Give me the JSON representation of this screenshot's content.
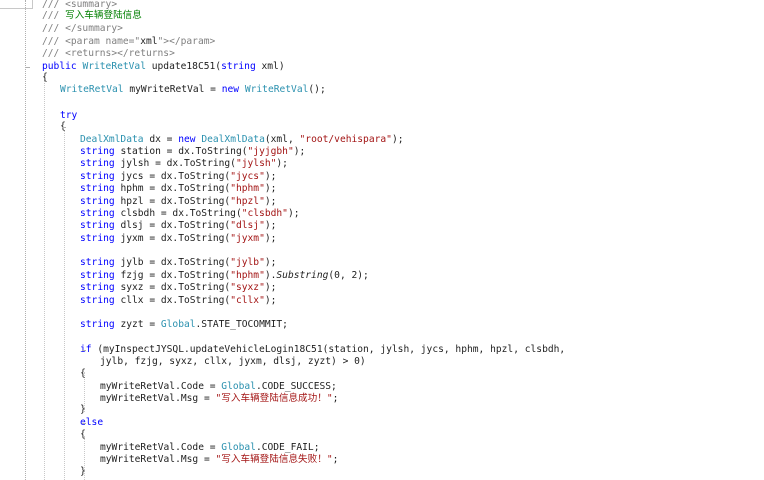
{
  "editor": {
    "lines": [
      [
        {
          "t": "/// ",
          "c": "com"
        },
        {
          "t": "<summary>",
          "c": "com"
        }
      ],
      [
        {
          "t": "/// ",
          "c": "com"
        },
        {
          "t": "写入车辆登陆信息",
          "c": "comtext"
        }
      ],
      [
        {
          "t": "/// ",
          "c": "com"
        },
        {
          "t": "</summary>",
          "c": "com"
        }
      ],
      [
        {
          "t": "/// ",
          "c": "com"
        },
        {
          "t": "<param name=\"",
          "c": "com"
        },
        {
          "t": "xml",
          "c": "plain"
        },
        {
          "t": "\"></param>",
          "c": "com"
        }
      ],
      [
        {
          "t": "/// ",
          "c": "com"
        },
        {
          "t": "<returns></returns>",
          "c": "com"
        }
      ],
      [
        {
          "t": "public ",
          "c": "kw"
        },
        {
          "t": "WriteRetVal ",
          "c": "type"
        },
        {
          "t": "update18C51(",
          "c": "plain"
        },
        {
          "t": "string ",
          "c": "kw"
        },
        {
          "t": "xml)",
          "c": "plain"
        }
      ],
      [
        {
          "t": "{",
          "c": "plain"
        }
      ],
      [],
      [
        {
          "t": "WriteRetVal ",
          "c": "type"
        },
        {
          "t": "myWriteRetVal = ",
          "c": "plain"
        },
        {
          "t": "new ",
          "c": "kw"
        },
        {
          "t": "WriteRetVal",
          "c": "type"
        },
        {
          "t": "();",
          "c": "plain"
        }
      ],
      [],
      [
        {
          "t": "try",
          "c": "kw"
        }
      ],
      [
        {
          "t": "{",
          "c": "plain"
        }
      ],
      [
        {
          "t": "DealXmlData ",
          "c": "type"
        },
        {
          "t": "dx = ",
          "c": "plain"
        },
        {
          "t": "new ",
          "c": "kw"
        },
        {
          "t": "DealXmlData",
          "c": "type"
        },
        {
          "t": "(xml, ",
          "c": "plain"
        },
        {
          "t": "\"root/vehispara\"",
          "c": "str"
        },
        {
          "t": ");",
          "c": "plain"
        }
      ],
      [
        {
          "t": "string ",
          "c": "kw"
        },
        {
          "t": "station = dx.ToString(",
          "c": "plain"
        },
        {
          "t": "\"jyjgbh\"",
          "c": "str"
        },
        {
          "t": ");",
          "c": "plain"
        }
      ],
      [
        {
          "t": "string ",
          "c": "kw"
        },
        {
          "t": "jylsh = dx.ToString(",
          "c": "plain"
        },
        {
          "t": "\"jylsh\"",
          "c": "str"
        },
        {
          "t": ");",
          "c": "plain"
        }
      ],
      [
        {
          "t": "string ",
          "c": "kw"
        },
        {
          "t": "jycs = dx.ToString(",
          "c": "plain"
        },
        {
          "t": "\"jycs\"",
          "c": "str"
        },
        {
          "t": ");",
          "c": "plain"
        }
      ],
      [
        {
          "t": "string ",
          "c": "kw"
        },
        {
          "t": "hphm = dx.ToString(",
          "c": "plain"
        },
        {
          "t": "\"hphm\"",
          "c": "str"
        },
        {
          "t": ");",
          "c": "plain"
        }
      ],
      [
        {
          "t": "string ",
          "c": "kw"
        },
        {
          "t": "hpzl = dx.ToString(",
          "c": "plain"
        },
        {
          "t": "\"hpzl\"",
          "c": "str"
        },
        {
          "t": ");",
          "c": "plain"
        }
      ],
      [
        {
          "t": "string ",
          "c": "kw"
        },
        {
          "t": "clsbdh = dx.ToString(",
          "c": "plain"
        },
        {
          "t": "\"clsbdh\"",
          "c": "str"
        },
        {
          "t": ");",
          "c": "plain"
        }
      ],
      [
        {
          "t": "string ",
          "c": "kw"
        },
        {
          "t": "dlsj = dx.ToString(",
          "c": "plain"
        },
        {
          "t": "\"dlsj\"",
          "c": "str"
        },
        {
          "t": ");",
          "c": "plain"
        }
      ],
      [
        {
          "t": "string ",
          "c": "kw"
        },
        {
          "t": "jyxm = dx.ToString(",
          "c": "plain"
        },
        {
          "t": "\"jyxm\"",
          "c": "str"
        },
        {
          "t": ");",
          "c": "plain"
        }
      ],
      [],
      [
        {
          "t": "string ",
          "c": "kw"
        },
        {
          "t": "jylb = dx.ToString(",
          "c": "plain"
        },
        {
          "t": "\"jylb\"",
          "c": "str"
        },
        {
          "t": ");",
          "c": "plain"
        }
      ],
      [
        {
          "t": "string ",
          "c": "kw"
        },
        {
          "t": "fzjg = dx.ToString(",
          "c": "plain"
        },
        {
          "t": "\"hphm\"",
          "c": "str"
        },
        {
          "t": ").",
          "c": "plain"
        },
        {
          "t": "Substring",
          "c": "it"
        },
        {
          "t": "(0, 2);",
          "c": "plain"
        }
      ],
      [
        {
          "t": "string ",
          "c": "kw"
        },
        {
          "t": "syxz = dx.ToString(",
          "c": "plain"
        },
        {
          "t": "\"syxz\"",
          "c": "str"
        },
        {
          "t": ");",
          "c": "plain"
        }
      ],
      [
        {
          "t": "string ",
          "c": "kw"
        },
        {
          "t": "cllx = dx.ToString(",
          "c": "plain"
        },
        {
          "t": "\"cllx\"",
          "c": "str"
        },
        {
          "t": ");",
          "c": "plain"
        }
      ],
      [],
      [
        {
          "t": "string ",
          "c": "kw"
        },
        {
          "t": "zyzt = ",
          "c": "plain"
        },
        {
          "t": "Global",
          "c": "type"
        },
        {
          "t": ".STATE_TOCOMMIT;",
          "c": "plain"
        }
      ],
      [],
      [
        {
          "t": "if ",
          "c": "kw"
        },
        {
          "t": "(myInspectJYSQL.updateVehicleLogin18C51(station, jylsh, jycs, hphm, hpzl, clsbdh,",
          "c": "plain"
        }
      ],
      [
        {
          "t": "jylb, fzjg, syxz, cllx, jyxm, dlsj, zyzt) > 0)",
          "c": "plain"
        }
      ],
      [
        {
          "t": "{",
          "c": "plain"
        }
      ],
      [
        {
          "t": "myWriteRetVal.Code = ",
          "c": "plain"
        },
        {
          "t": "Global",
          "c": "type"
        },
        {
          "t": ".CODE_SUCCESS;",
          "c": "plain"
        }
      ],
      [
        {
          "t": "myWriteRetVal.Msg = ",
          "c": "plain"
        },
        {
          "t": "\"写入车辆登陆信息成功！\"",
          "c": "str"
        },
        {
          "t": ";",
          "c": "plain"
        }
      ],
      [
        {
          "t": "}",
          "c": "plain"
        }
      ],
      [
        {
          "t": "else",
          "c": "kw"
        }
      ],
      [
        {
          "t": "{",
          "c": "plain"
        }
      ],
      [
        {
          "t": "myWriteRetVal.Code = ",
          "c": "plain"
        },
        {
          "t": "Global",
          "c": "type"
        },
        {
          "t": ".CODE_FAIL;",
          "c": "plain"
        }
      ],
      [
        {
          "t": "myWriteRetVal.Msg = ",
          "c": "plain"
        },
        {
          "t": "\"写入车辆登陆信息失败！\"",
          "c": "str"
        },
        {
          "t": ";",
          "c": "plain"
        }
      ],
      [
        {
          "t": "}",
          "c": "plain"
        }
      ]
    ]
  },
  "colors": {
    "background": "#ffffff",
    "comment": "#808080",
    "comment_text": "#008000",
    "keyword": "#0000ff",
    "type": "#2b91af",
    "string": "#a31515",
    "plain": "#1e1e1e"
  }
}
